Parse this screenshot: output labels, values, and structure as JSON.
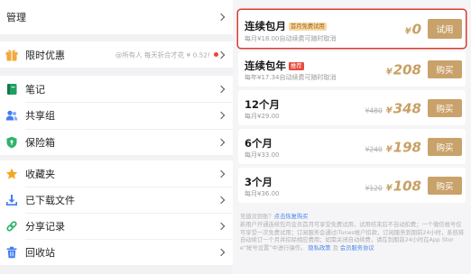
{
  "menu": {
    "manage": {
      "label": "管理"
    },
    "promo": {
      "label": "限时优惠",
      "note": "@所有人 每天折合才花 ¥ 0.52!",
      "icon": "gift-icon",
      "icon_color": "#f3a83b"
    },
    "tools": [
      {
        "label": "笔记",
        "icon": "note-icon",
        "icon_color": "#1e9e63"
      },
      {
        "label": "共享组",
        "icon": "share-group-icon",
        "icon_color": "#3f7df3"
      },
      {
        "label": "保险箱",
        "icon": "vault-shield-icon",
        "icon_color": "#2fb36e"
      }
    ],
    "files": [
      {
        "label": "收藏夹",
        "icon": "star-icon",
        "icon_color": "#f5a623"
      },
      {
        "label": "已下载文件",
        "icon": "download-icon",
        "icon_color": "#3f7df3"
      },
      {
        "label": "分享记录",
        "icon": "link-icon",
        "icon_color": "#2fb36e"
      },
      {
        "label": "回收站",
        "icon": "trash-icon",
        "icon_color": "#3f7df3"
      }
    ]
  },
  "plans": [
    {
      "title": "连续包月",
      "badge": "首月免费试用",
      "subtitle": "每月¥18.00自动续费可随时取消",
      "currency": "¥",
      "amount": "0",
      "button": "试用",
      "selected": true
    },
    {
      "title": "连续包年",
      "badge": "推荐",
      "subtitle": "每年¥17.34自动续费可随时取消",
      "currency": "¥",
      "amount": "208",
      "button": "购买"
    },
    {
      "title": "12个月",
      "subtitle": "每月¥29.00",
      "original_price": "¥480",
      "currency": "¥",
      "amount": "348",
      "button": "购买"
    },
    {
      "title": "6个月",
      "subtitle": "每月¥33.00",
      "original_price": "¥240",
      "currency": "¥",
      "amount": "198",
      "button": "购买"
    },
    {
      "title": "3个月",
      "subtitle": "每月¥36.00",
      "original_price": "¥120",
      "currency": "¥",
      "amount": "108",
      "button": "购买"
    }
  ],
  "footer": {
    "restore_prefix": "充值没到账？",
    "restore_link": "点击恢复购买",
    "terms": "新用户开通连续包月会员首月可享受免费试用，试用结束后不自动扣费；一个微信帐号仅可享受一次免费试用；订阅服务会通过iTunes帐户扣款，订阅服务到期前24小时，系统将自动续订一个月并扣除相应费用；如需关闭自动续费，请在到期前24小时在App Store“帐号设置”中进行操作。",
    "privacy_link": "隐私政策",
    "conjunction": "及",
    "service_link": "会员服务协议"
  },
  "colors": {
    "button": "#c9a26b",
    "price": "#c8a064",
    "selected_border": "#d93a2f",
    "link": "#4c86e6",
    "recommend_badge": "#e64a3d",
    "trial_badge_bg": "#f6d8a5",
    "trial_badge_text": "#a3661c",
    "notification_dot": "#f0433a"
  }
}
